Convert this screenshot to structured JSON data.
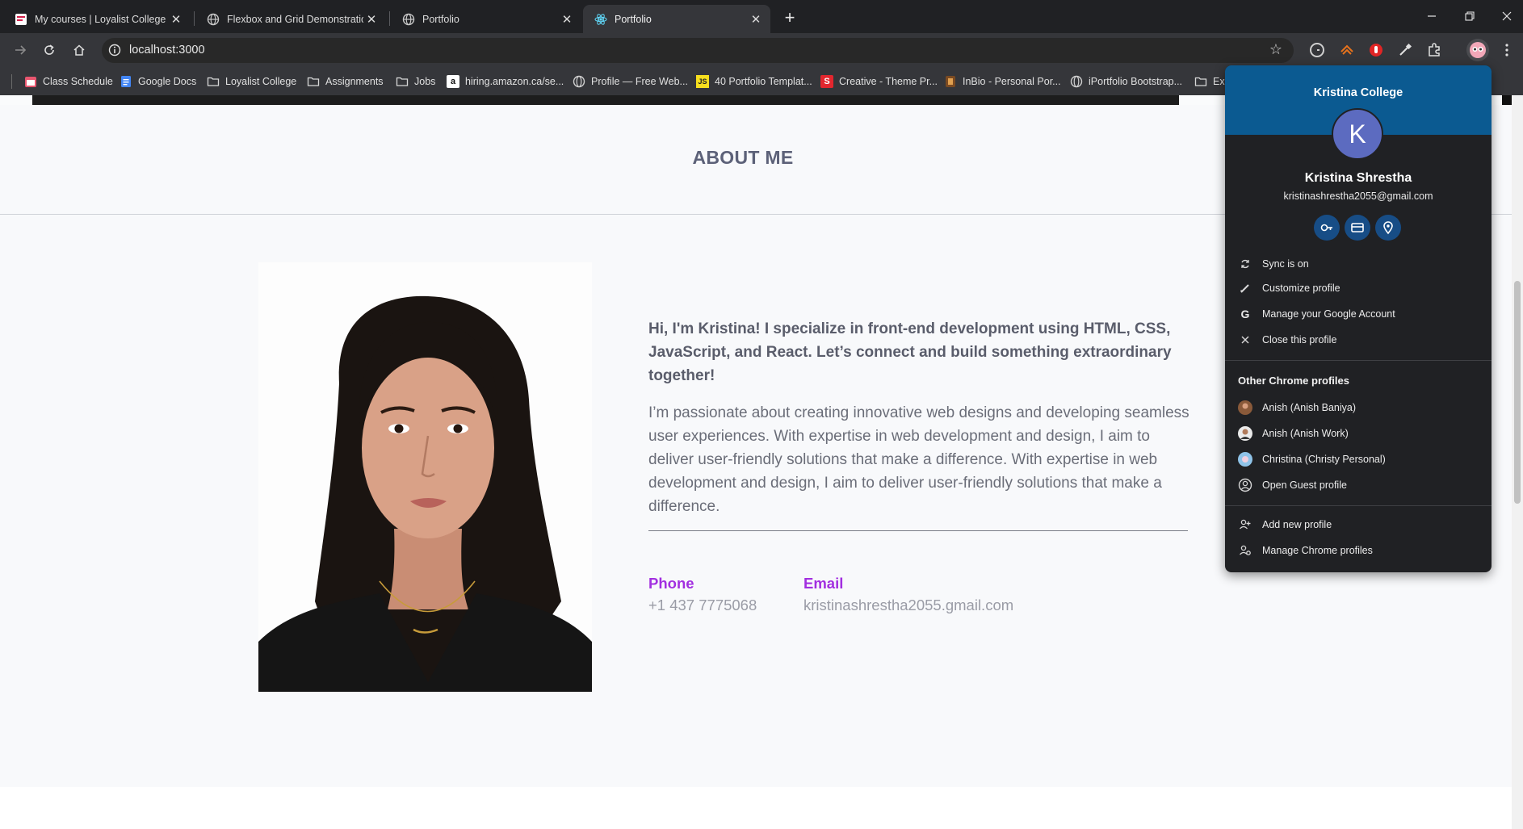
{
  "tabs": [
    {
      "title": "My courses | Loyalist College In",
      "favicon": "loyalist-icon",
      "active": false
    },
    {
      "title": "Flexbox and Grid Demonstratio",
      "favicon": "globe-icon",
      "active": false
    },
    {
      "title": "Portfolio",
      "favicon": "globe-icon",
      "active": false
    },
    {
      "title": "Portfolio",
      "favicon": "react-icon",
      "active": true
    }
  ],
  "new_tab_label": "+",
  "address_bar": {
    "url": "localhost:3000"
  },
  "bookmarks": [
    {
      "label": "Class Schedule",
      "icon": "calendar-icon"
    },
    {
      "label": "Google Docs",
      "icon": "docs-icon"
    },
    {
      "label": "Loyalist College",
      "icon": "folder-icon"
    },
    {
      "label": "Assignments",
      "icon": "folder-icon"
    },
    {
      "label": "Jobs",
      "icon": "folder-icon"
    },
    {
      "label": "hiring.amazon.ca/se...",
      "icon": "amazon-icon"
    },
    {
      "label": "Profile — Free Web...",
      "icon": "globe-icon"
    },
    {
      "label": "40 Portfolio Templat...",
      "icon": "js-icon"
    },
    {
      "label": "Creative - Theme Pr...",
      "icon": "s-logo-icon"
    },
    {
      "label": "InBio - Personal Por...",
      "icon": "inbio-icon"
    },
    {
      "label": "iPortfolio Bootstrap...",
      "icon": "globe-icon"
    },
    {
      "label": "Ex",
      "icon": "folder-icon"
    }
  ],
  "page": {
    "section_title": "ABOUT ME",
    "intro": "Hi, I'm Kristina! I specialize in front-end development using HTML, CSS, JavaScript, and React. Let’s connect and build something extraordinary together!",
    "body": "I’m passionate about creating innovative web designs and developing seamless user experiences. With expertise in web development and design, I aim to deliver user-friendly solutions that make a difference. With expertise in web development and design, I aim to deliver user-friendly solutions that make a difference.",
    "contact": {
      "phone_label": "Phone",
      "phone_value": "+1 437 7775068",
      "email_label": "Email",
      "email_value": "kristinashrestha2055.gmail.com"
    }
  },
  "profile_menu": {
    "org": "Kristina College",
    "avatar_letter": "K",
    "name": "Kristina Shrestha",
    "email": "kristinashrestha2055@gmail.com",
    "quick_actions": [
      "key-icon",
      "card-icon",
      "location-pin-icon"
    ],
    "items": [
      {
        "label": "Sync is on",
        "icon": "sync-icon"
      },
      {
        "label": "Customize profile",
        "icon": "pencil-icon"
      },
      {
        "label": "Manage your Google Account",
        "icon": "google-g-icon"
      },
      {
        "label": "Close this profile",
        "icon": "close-icon"
      }
    ],
    "other_heading": "Other Chrome profiles",
    "other_profiles": [
      {
        "label": "Anish (Anish Baniya)"
      },
      {
        "label": "Anish (Anish Work)"
      },
      {
        "label": "Christina (Christy Personal)"
      },
      {
        "label": "Open Guest profile"
      }
    ],
    "footer": [
      {
        "label": "Add new profile",
        "icon": "add-person-icon"
      },
      {
        "label": "Manage Chrome profiles",
        "icon": "manage-people-icon"
      }
    ]
  },
  "colors": {
    "accent_purple": "#a22fe0",
    "banner_blue": "#0b5a91",
    "avatar_indigo": "#5c6bc0"
  }
}
